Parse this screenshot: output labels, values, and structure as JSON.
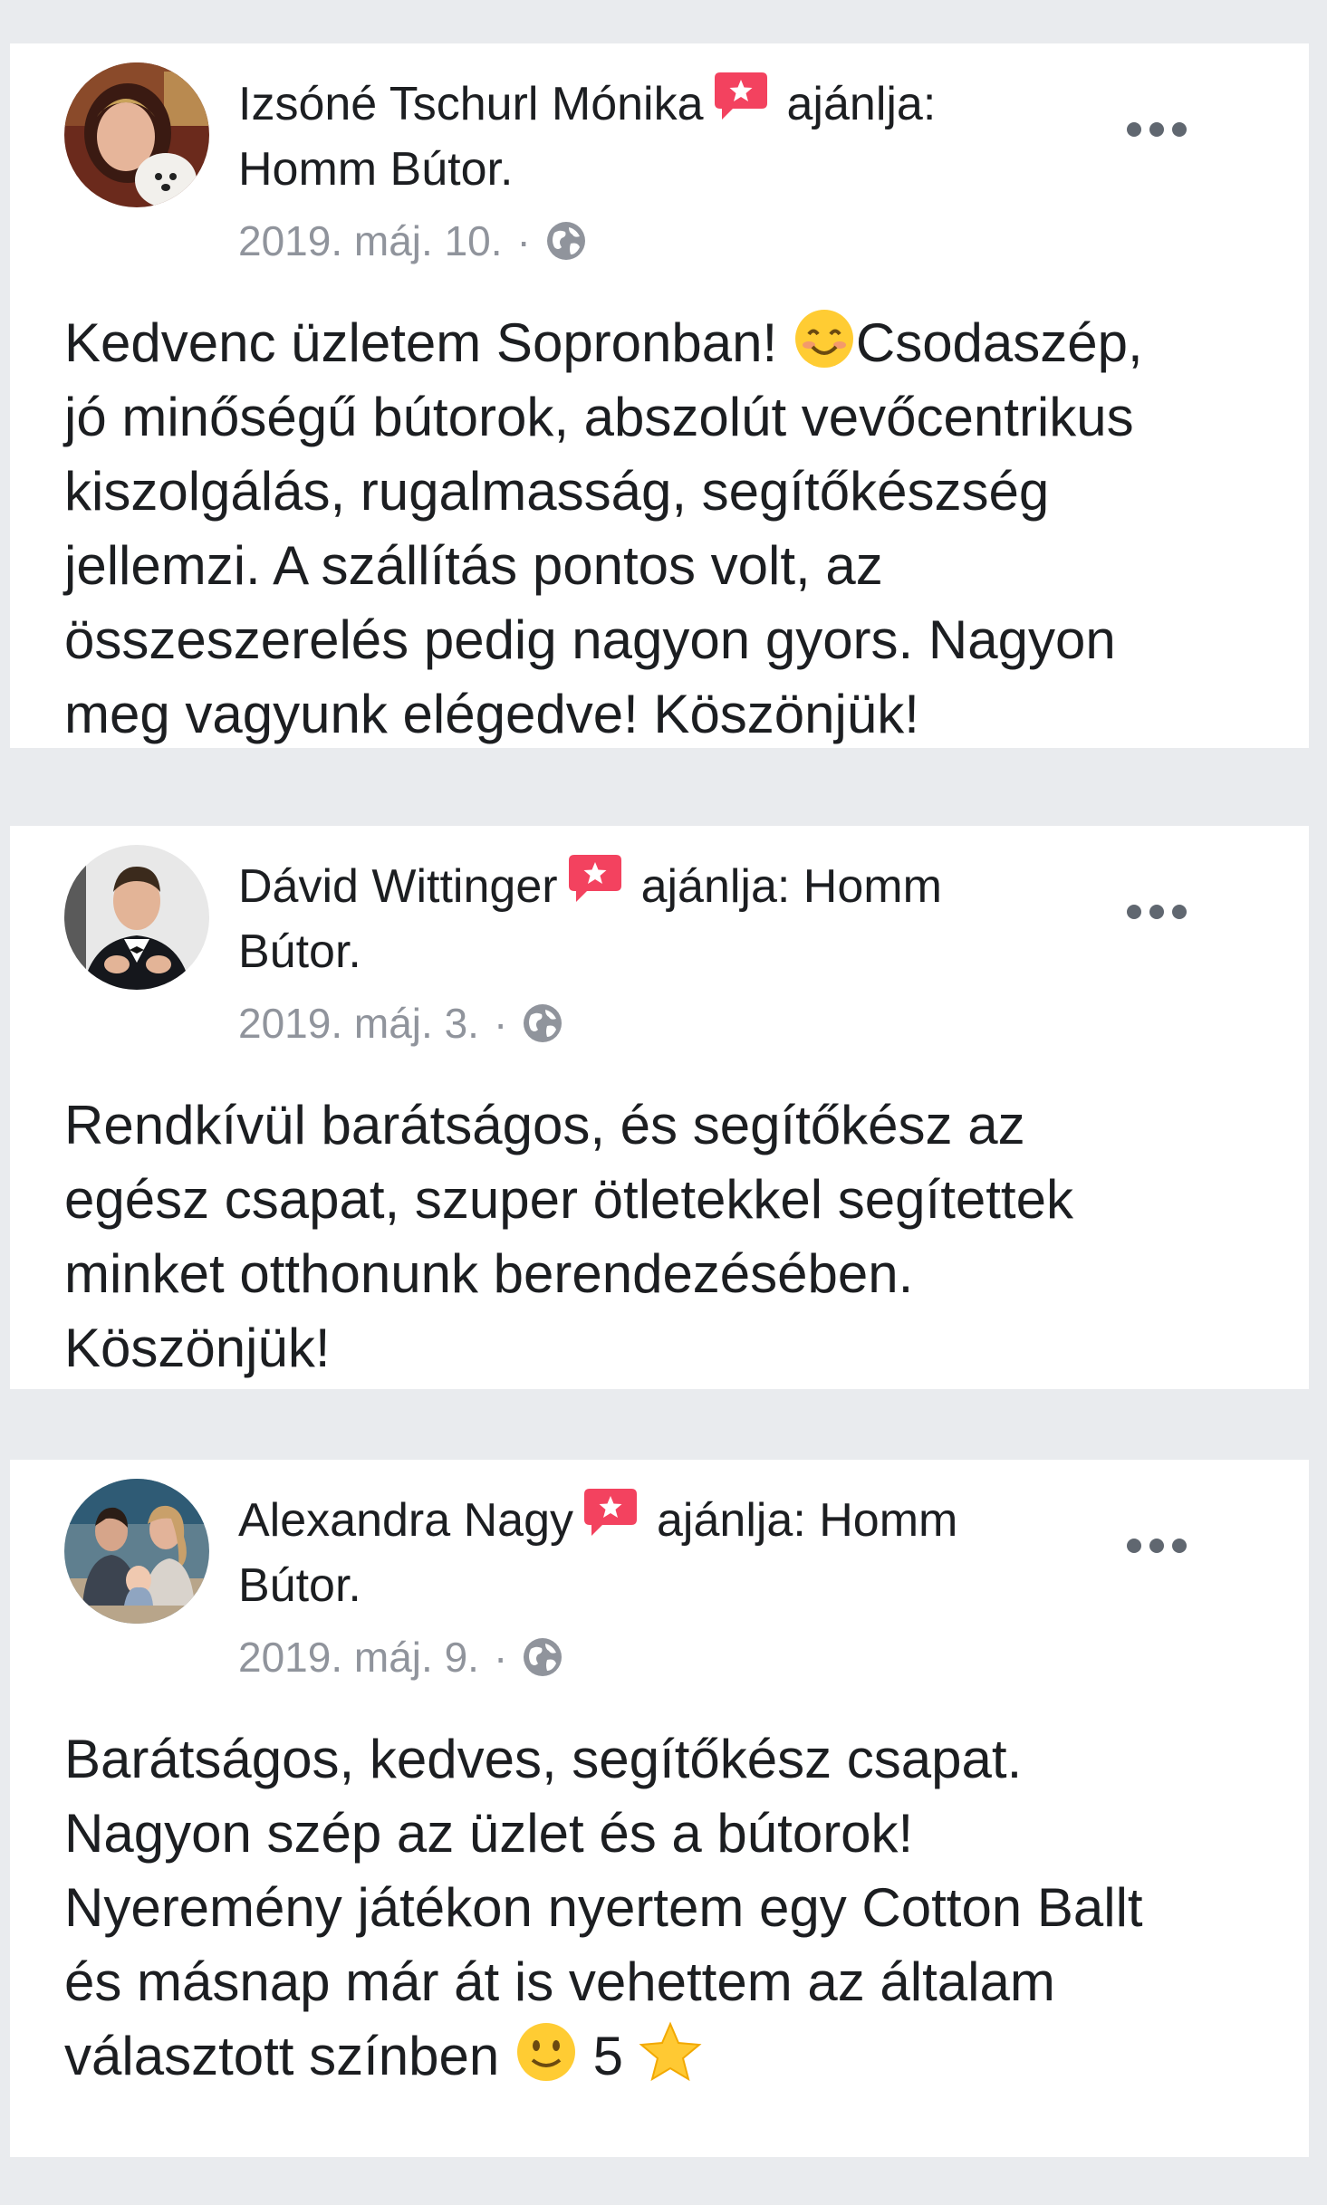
{
  "reviews": [
    {
      "author": "Izsóné Tschurl Mónika",
      "action": "ajánlja:",
      "page": "Homm Bútor.",
      "date": "2019. máj. 10.",
      "separator": "·",
      "text_1": "Kedvenc üzletem Sopronban! ",
      "emoji_1": "smiling-face-icon",
      "text_2": "Csodaszép,\njó minőségű bútorok, abszolút vevőcentrikus\nkiszolgálás, rugalmasság, segítőkészség\njellemzi. A szállítás pontos volt, az\nösszeszerelés pedig nagyon gyors. Nagyon\nmeg vagyunk elégedve! Köszönjük!"
    },
    {
      "author": "Dávid Wittinger",
      "action": "ajánlja: Homm",
      "page": "Bútor.",
      "date": "2019. máj. 3.",
      "separator": "·",
      "text_1": "Rendkívül barátságos, és segítőkész az\negész csapat, szuper ötletekkel segítettek\nminket otthonunk berendezésében.\nKöszönjük!"
    },
    {
      "author": "Alexandra Nagy",
      "action": "ajánlja: Homm",
      "page": "Bútor.",
      "date": "2019. máj. 9.",
      "separator": "·",
      "text_1": "Barátságos, kedves, segítőkész csapat.\nNagyon szép az üzlet és a bútorok!\nNyeremény játékon nyertem egy Cotton Ballt\nés másnap már át is vehettem az általam\nválasztott színben ",
      "emoji_1": "slightly-smiling-face-icon",
      "text_2": " 5 ",
      "emoji_2": "star-icon"
    }
  ],
  "colors": {
    "background": "#e9ebee",
    "card": "#ffffff",
    "text": "#1c1e21",
    "meta": "#90949c",
    "badge": "#f3425f"
  }
}
